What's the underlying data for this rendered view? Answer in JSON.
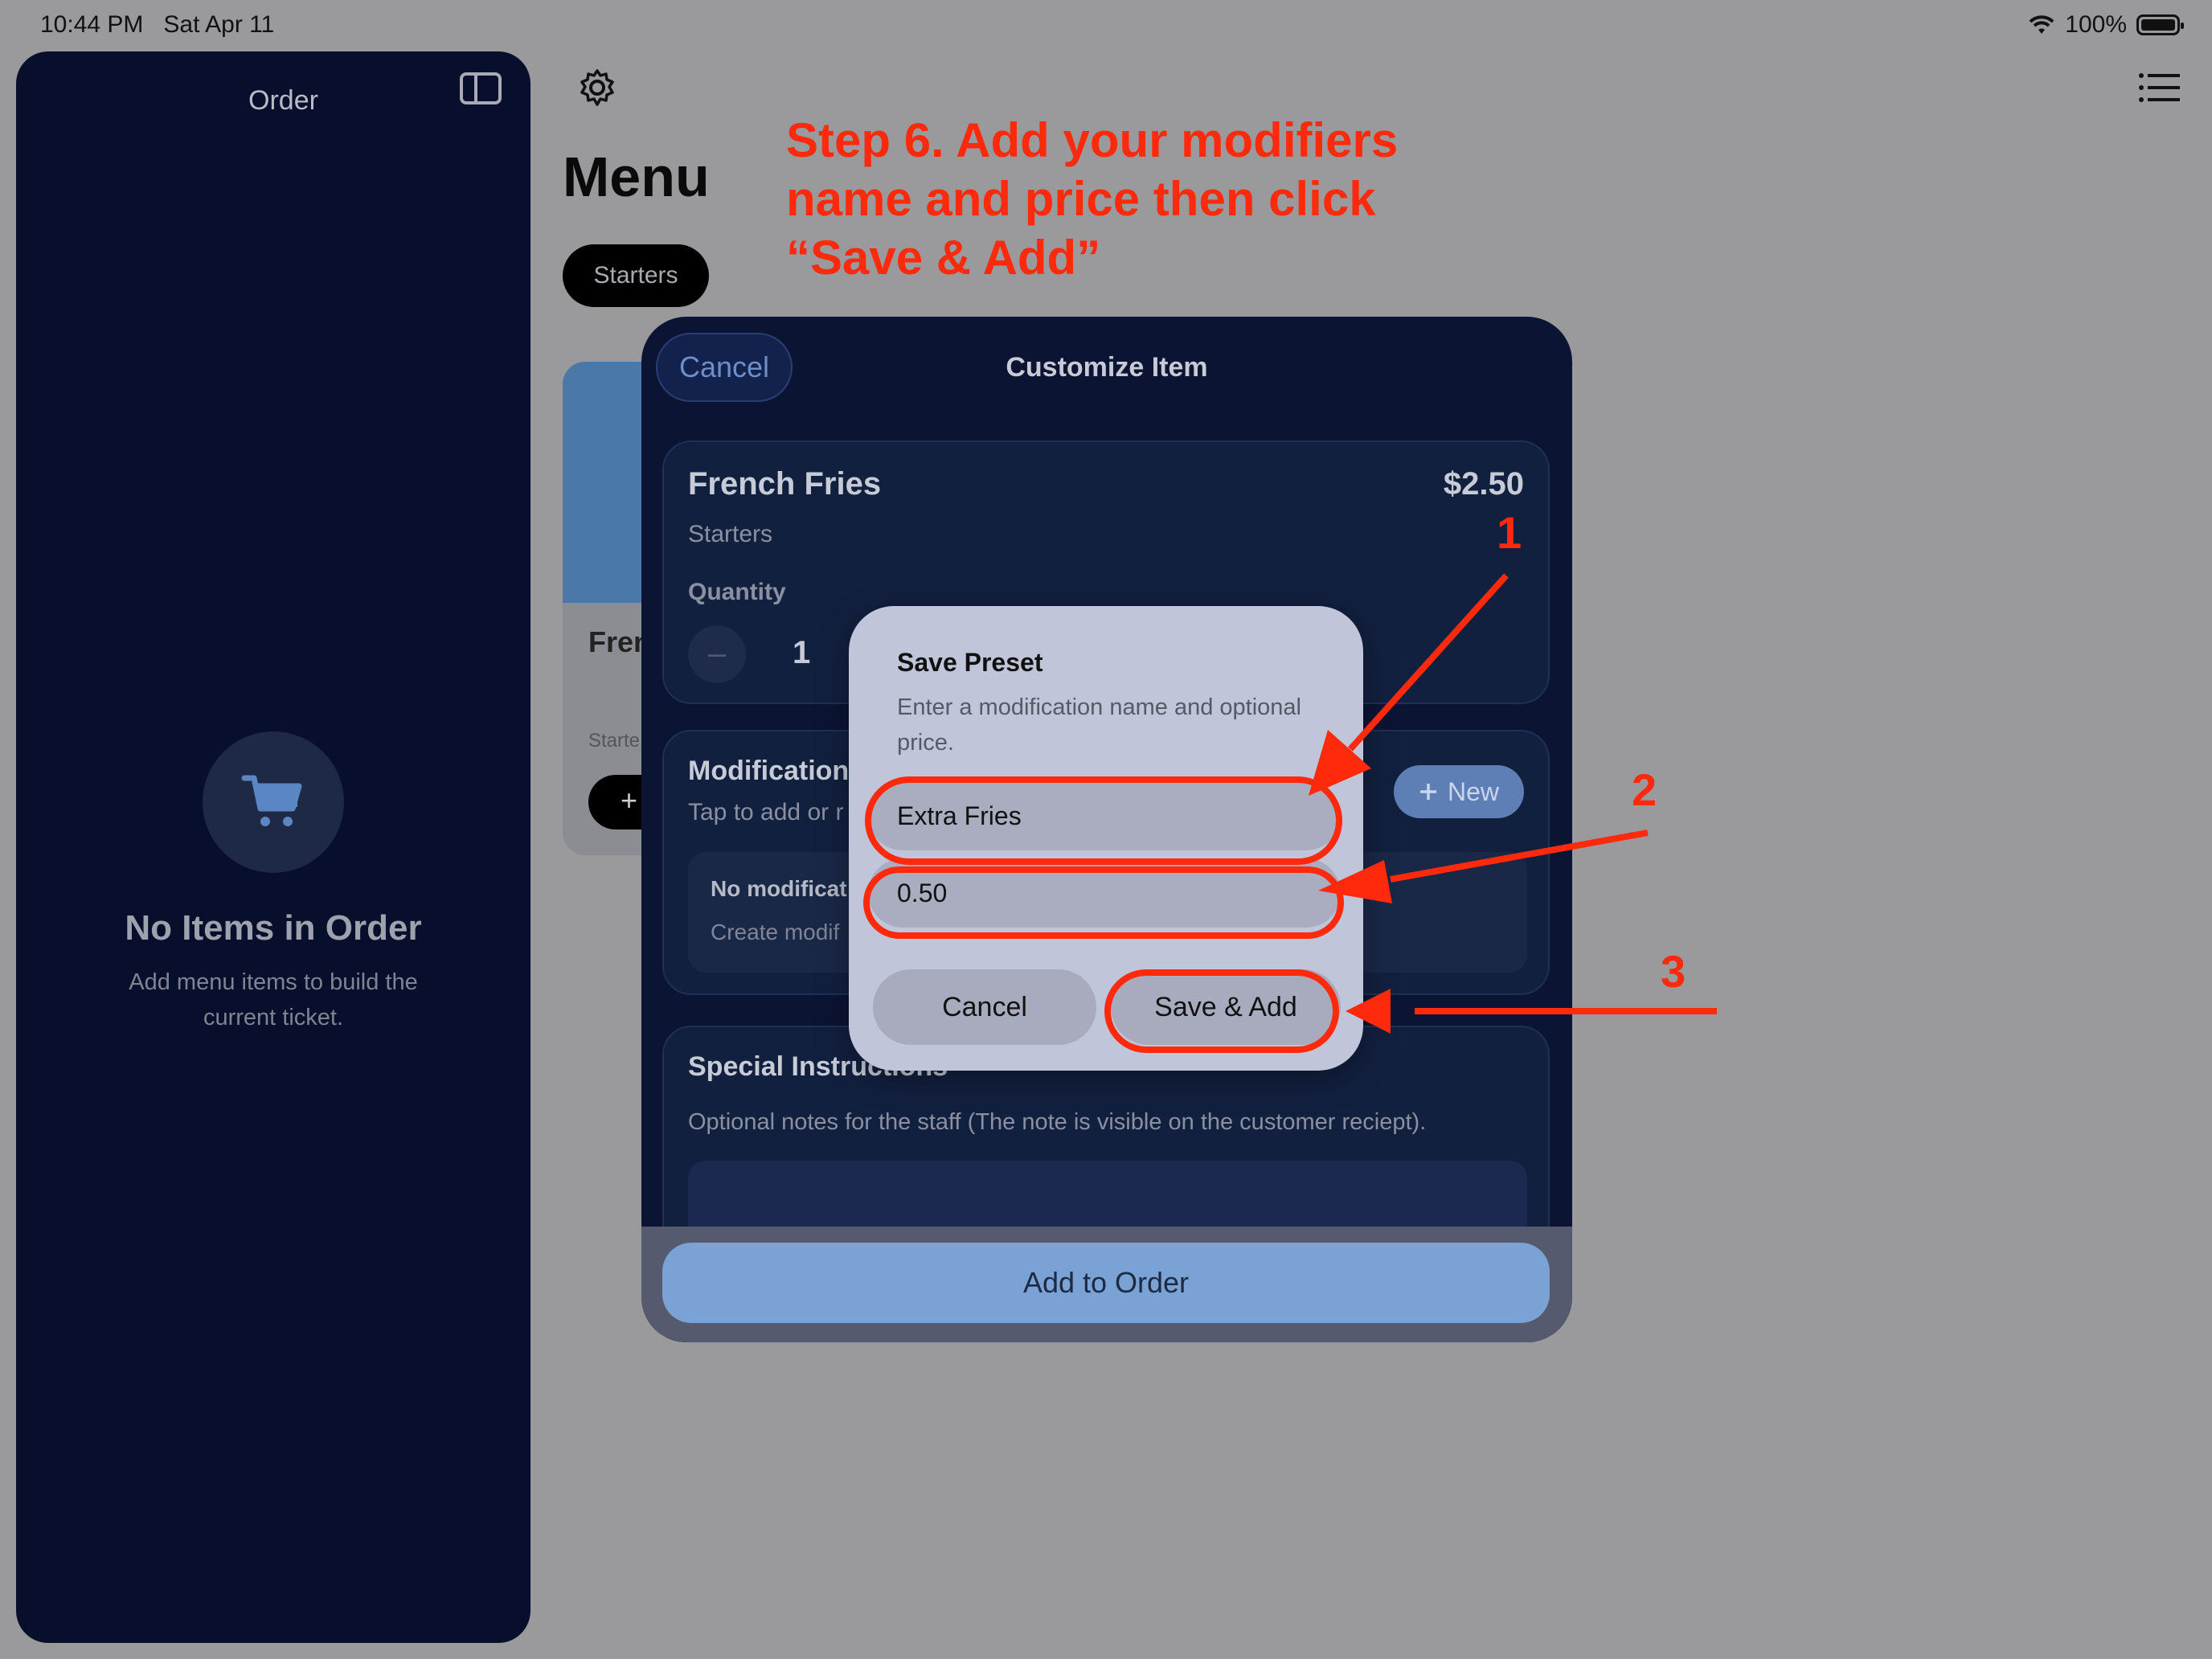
{
  "status_bar": {
    "time": "10:44 PM   Sat Apr 11",
    "battery": "100%"
  },
  "sidebar": {
    "title": "Order",
    "empty_title": "No Items in Order",
    "empty_subtitle": "Add menu items to build the current ticket."
  },
  "menu": {
    "title": "Menu",
    "category": "Starters",
    "card": {
      "name": "Fren",
      "category": "Starte",
      "add": "+"
    }
  },
  "instruction": "Step 6. Add your modifiers name and price then click “Save & Add”",
  "customize": {
    "cancel": "Cancel",
    "title": "Customize Item",
    "item_name": "French Fries",
    "item_price": "$2.50",
    "item_category": "Starters",
    "quantity_label": "Quantity",
    "quantity_minus": "–",
    "quantity": "1",
    "modifications_title": "Modifications",
    "modifications_subtitle": "Tap to add or r",
    "new_button": "New",
    "no_mods_title": "No modificat",
    "no_mods_subtitle": "Create modif",
    "special_title": "Special Instructions",
    "special_subtitle": "Optional notes for the staff (The note is visible on the customer reciept).",
    "add_to_order": "Add to Order"
  },
  "save_preset": {
    "title": "Save Preset",
    "message": "Enter a modification name and optional price.",
    "name_value": "Extra Fries",
    "price_value": "0.50",
    "cancel": "Cancel",
    "save": "Save & Add"
  },
  "annotations": {
    "step1": "1",
    "step2": "2",
    "step3": "3"
  },
  "colors": {
    "annotation": "#ff2a0c",
    "sidebar_bg": "#080f2c",
    "sheet_bg": "#0b1433",
    "accent": "#7ba2d4"
  }
}
